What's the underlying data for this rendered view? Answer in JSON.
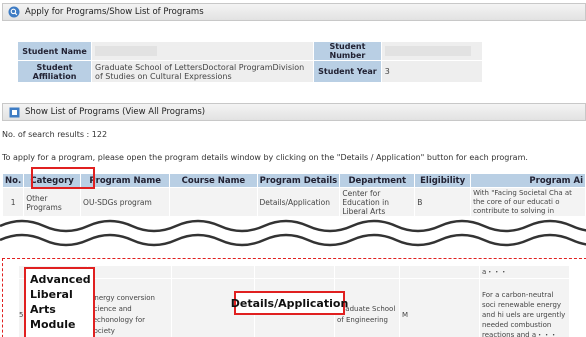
{
  "apply_panel": {
    "title": "Apply for Programs/Show List of Programs"
  },
  "student": {
    "name_label": "Student Name",
    "number_label": "Student Number",
    "affiliation_label": "Student Affiliation",
    "affiliation_value": "Graduate School of LettersDoctoral ProgramDivision of Studies on Cultural Expressions",
    "year_label": "Student Year",
    "year_value": "3"
  },
  "list_panel": {
    "title": "Show List of Programs (View All Programs)"
  },
  "search_results": "No. of search results : 122",
  "instruction": "To apply for a program, please open the program details window by clicking on the \"Details / Application\" button for each program.",
  "table": {
    "headers": [
      "No.",
      "Category",
      "Program Name",
      "Course Name",
      "Program Details",
      "Department",
      "Eligibility",
      "Program Ai"
    ],
    "row1": {
      "no": "1",
      "category": "Other Programs",
      "program_name": "OU-SDGs program",
      "course_name": "",
      "details": "Details/Application",
      "department": "Center for Education in Liberal Arts",
      "eligibility": "B",
      "aim": "With \"Facing Societal Cha at the core of our educati o contribute to solving in"
    },
    "row2": {
      "no_fragment": "5",
      "category": "Advanced Liberal Arts Module",
      "program_name": "Energy conversion science and techonology for society",
      "course_name": "",
      "details": "Details/Application",
      "department": "Graduate School of Engineering",
      "eligibility": "M",
      "aim_top": "a・・・",
      "aim": "For a carbon-neutral soci renewable energy and hi uels are urgently needed combustion reactions and a・・・"
    }
  },
  "colors": {
    "header_blue": "#b9cfe4",
    "highlight_red": "#e02020"
  },
  "icons": [
    "search-icon",
    "list-icon"
  ]
}
